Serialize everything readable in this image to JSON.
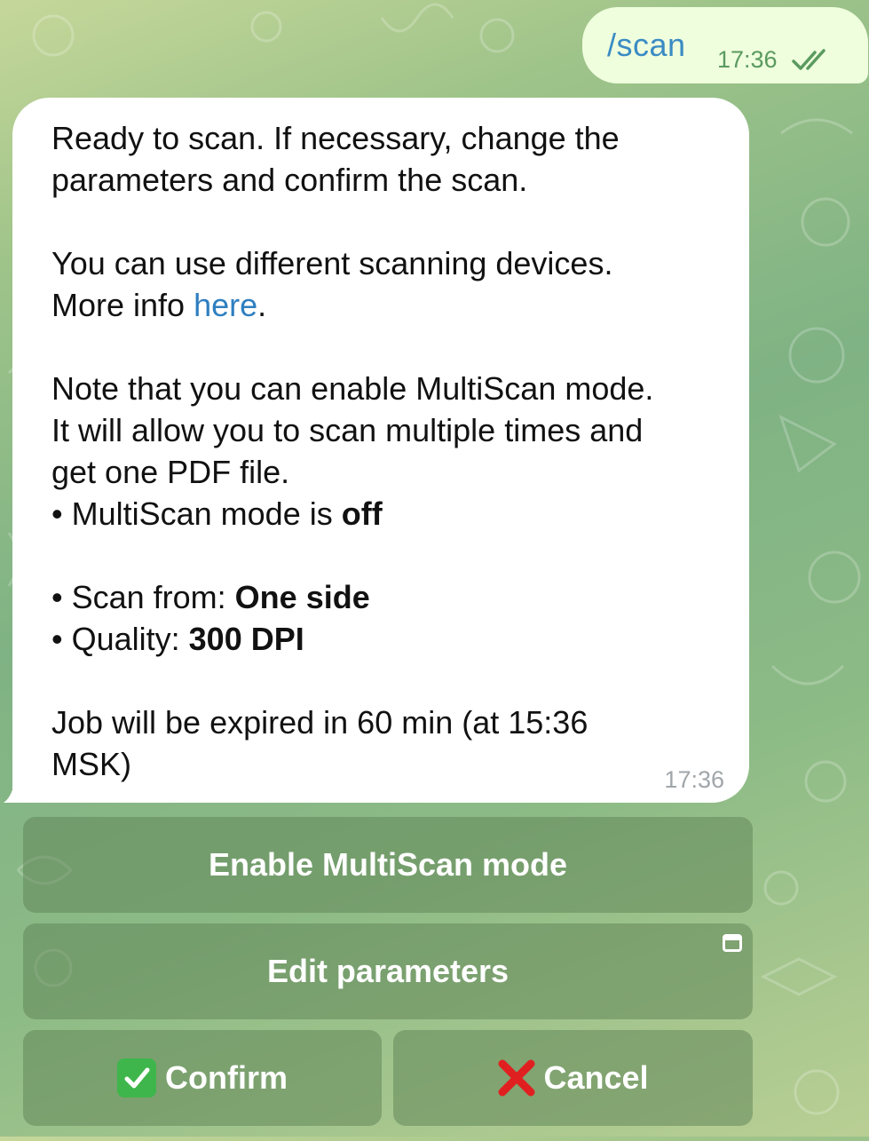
{
  "colors": {
    "outgoing_bubble": "#effedd",
    "incoming_bubble": "#ffffff",
    "link": "#2e7fc0",
    "button_bg": "#62865a",
    "confirm_emoji": "#3fb64b",
    "cancel_emoji": "#e02020"
  },
  "outgoing": {
    "text": "/scan",
    "time": "17:36",
    "status_icon": "double-check-icon"
  },
  "incoming": {
    "line1": "Ready to scan. If necessary, change the",
    "line2": "parameters and confirm the scan.",
    "line3": "You can use different scanning devices.",
    "line4_prefix": "More info ",
    "line4_link": "here",
    "line4_suffix": ".",
    "line5": "Note that you can enable MultiScan mode.",
    "line6": "It will allow you to scan multiple times and",
    "line7": "get one PDF file.",
    "multiscan_prefix": "• MultiScan mode is ",
    "multiscan_value": "off",
    "scan_from_prefix": "• Scan from: ",
    "scan_from_value": "One side",
    "quality_prefix": "• Quality: ",
    "quality_value": "300 DPI",
    "expire_line1": "Job will be expired in 60 min (at 15:36",
    "expire_line2": "MSK)",
    "time": "17:36"
  },
  "keyboard": {
    "multiscan_label": "Enable MultiScan mode",
    "edit_label": "Edit parameters",
    "edit_icon": "web-app-icon",
    "confirm_label": "Confirm",
    "confirm_icon": "check-mark-button-icon",
    "cancel_label": "Cancel",
    "cancel_icon": "cross-mark-icon"
  }
}
